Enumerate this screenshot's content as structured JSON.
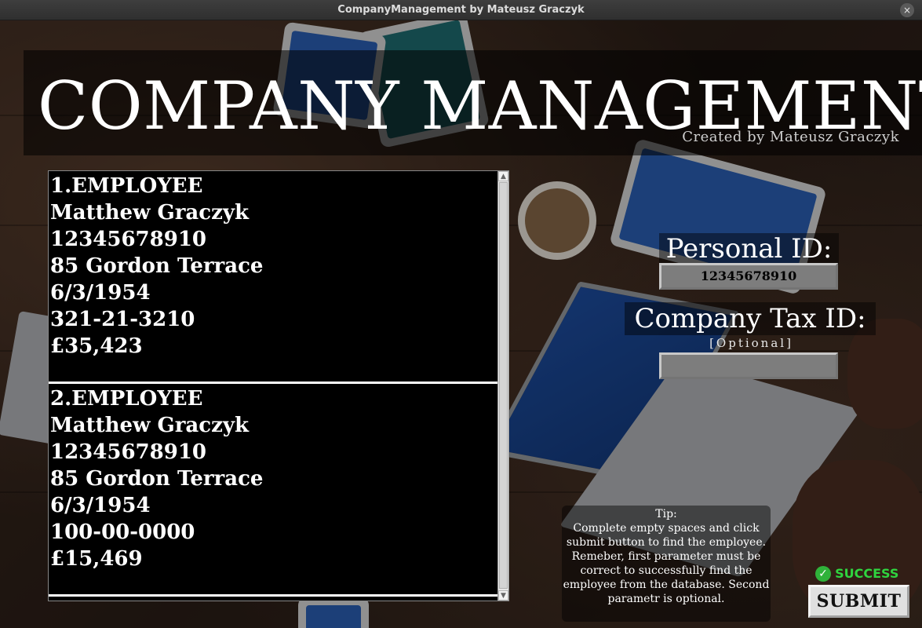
{
  "window": {
    "title": "CompanyManagement by Mateusz Graczyk",
    "close_glyph": "×"
  },
  "header": {
    "title": "COMPANY MANAGEMENT",
    "subtitle": "Created by Mateusz Graczyk"
  },
  "employees": [
    {
      "heading": "1.EMPLOYEE",
      "name": "Matthew Graczyk",
      "personal_id": "12345678910",
      "address": "85 Gordon Terrace",
      "birth_date": "6/3/1954",
      "tax_id": "321-21-3210",
      "salary": "£35,423"
    },
    {
      "heading": "2.EMPLOYEE",
      "name": "Matthew Graczyk",
      "personal_id": "12345678910",
      "address": "85 Gordon Terrace",
      "birth_date": "6/3/1954",
      "tax_id": "100-00-0000",
      "salary": "£15,469"
    }
  ],
  "form": {
    "personal_id_label": "Personal ID:",
    "personal_id_value": "12345678910",
    "company_tax_label": "Company Tax ID:",
    "optional_note": "[Optional]",
    "company_tax_value": ""
  },
  "tip": {
    "title": "Tip:",
    "body": "Complete empty spaces and click submit button to find the employee. Remeber, first parameter must be correct to successfully find the employee from the database. Second parametr is optional."
  },
  "status": {
    "icon": "check-icon",
    "text": "SUCCESS",
    "color": "#2fd43f"
  },
  "submit_label": "SUBMIT",
  "scrollbar": {
    "up_glyph": "▲",
    "down_glyph": "▼"
  }
}
